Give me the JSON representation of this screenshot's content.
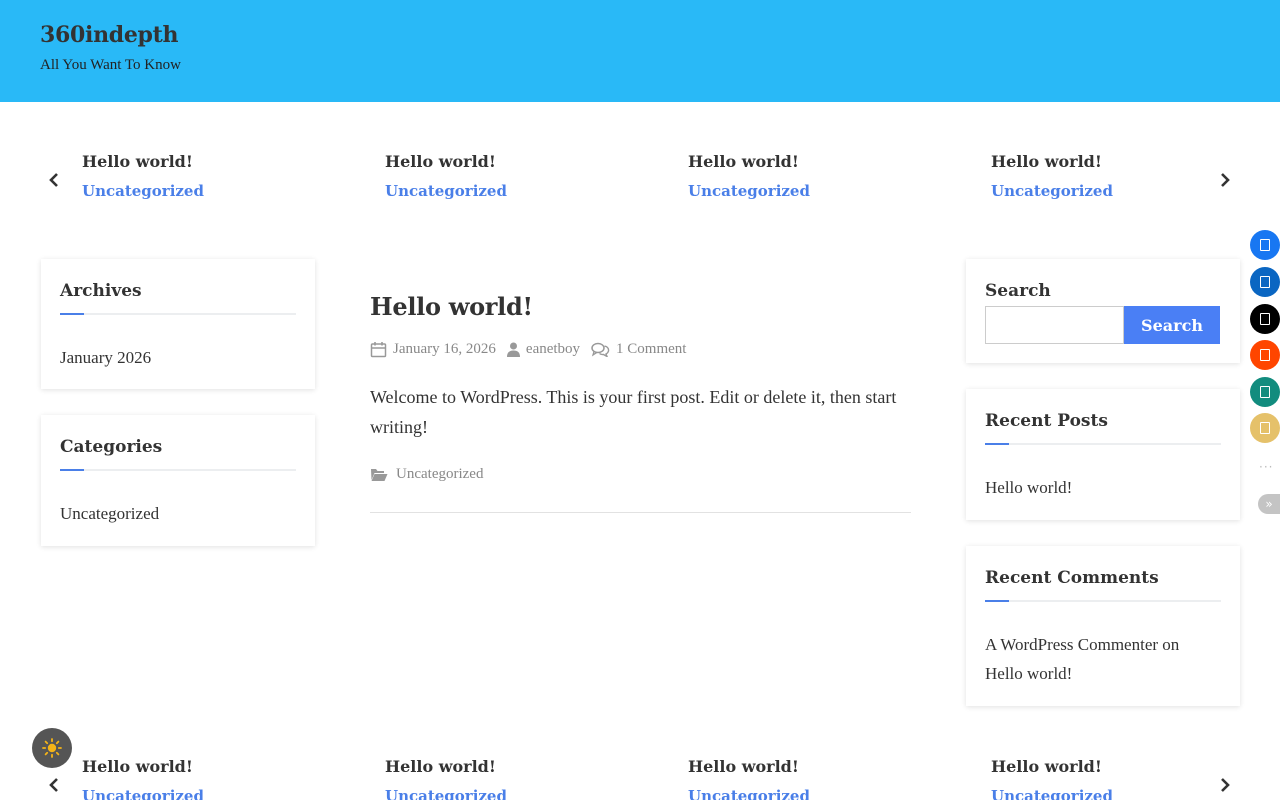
{
  "header": {
    "title": "360indepth",
    "tagline": "All You Want To Know",
    "bg_color": "#29b9f7"
  },
  "carousel_top": {
    "items": [
      {
        "title": "Hello world!",
        "category": "Uncategorized"
      },
      {
        "title": "Hello world!",
        "category": "Uncategorized"
      },
      {
        "title": "Hello world!",
        "category": "Uncategorized"
      },
      {
        "title": "Hello world!",
        "category": "Uncategorized"
      }
    ]
  },
  "carousel_bottom": {
    "items": [
      {
        "title": "Hello world!",
        "category": "Uncategorized"
      },
      {
        "title": "Hello world!",
        "category": "Uncategorized"
      },
      {
        "title": "Hello world!",
        "category": "Uncategorized"
      },
      {
        "title": "Hello world!",
        "category": "Uncategorized"
      }
    ]
  },
  "left_sidebar": {
    "archives": {
      "title": "Archives",
      "items": [
        "January 2026"
      ]
    },
    "categories": {
      "title": "Categories",
      "items": [
        "Uncategorized"
      ]
    }
  },
  "post": {
    "title": "Hello world!",
    "date": "January 16, 2026",
    "author": "eanetboy",
    "comments": "1 Comment",
    "content": "Welcome to WordPress. This is your first post. Edit or delete it, then start writing!",
    "category": "Uncategorized"
  },
  "right_sidebar": {
    "search": {
      "title": "Search",
      "button_label": "Search",
      "placeholder": ""
    },
    "recent_posts": {
      "title": "Recent Posts",
      "items": [
        "Hello world!"
      ]
    },
    "recent_comments": {
      "title": "Recent Comments",
      "author": "A WordPress Commenter",
      "on_word": "on",
      "post": "Hello world!"
    }
  },
  "share_bar": {
    "buttons": [
      {
        "icon": "facebook-icon",
        "color": "#1877f2"
      },
      {
        "icon": "linkedin-icon",
        "color": "#0a66c2"
      },
      {
        "icon": "x-twitter-icon",
        "color": "#000000"
      },
      {
        "icon": "reddit-icon",
        "color": "#ff4500"
      },
      {
        "icon": "whatsapp-icon",
        "color": "#128c7e"
      },
      {
        "icon": "email-icon",
        "color": "#e5c16a"
      }
    ],
    "more": "···",
    "collapse": "»"
  },
  "colors": {
    "accent": "#4a7fe8",
    "header": "#29b9f7",
    "search_button": "#4a7ff5"
  }
}
